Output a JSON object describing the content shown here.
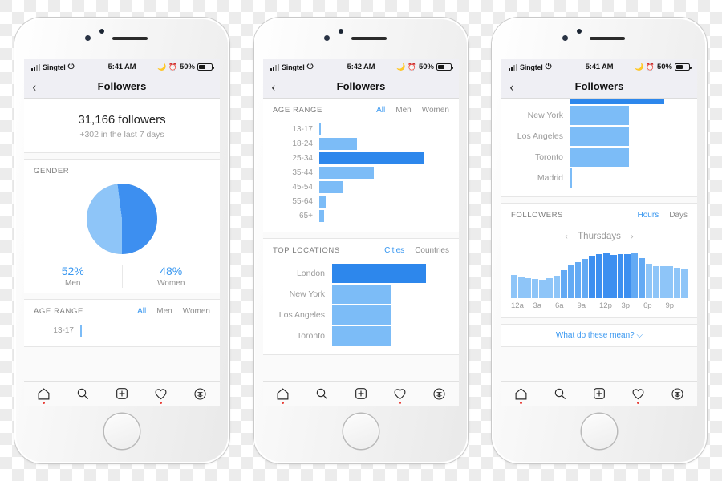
{
  "phones": [
    {
      "id": "phone-1",
      "status": {
        "carrier": "Singtel",
        "time": "5:41 AM",
        "battery": "50%"
      },
      "nav": {
        "back": "‹",
        "title": "Followers"
      },
      "summary": {
        "count": "31,166 followers",
        "delta": "+302 in the last 7 days"
      },
      "gender": {
        "title": "GENDER",
        "men_pct": "52%",
        "men_label": "Men",
        "women_pct": "48%",
        "women_label": "Women"
      },
      "age": {
        "title": "AGE RANGE",
        "segments": [
          "All",
          "Men",
          "Women"
        ],
        "active": "All",
        "rows": [
          {
            "label": "13-17",
            "value": 2
          }
        ]
      }
    },
    {
      "id": "phone-2",
      "status": {
        "carrier": "Singtel",
        "time": "5:42 AM",
        "battery": "50%"
      },
      "nav": {
        "back": "‹",
        "title": "Followers"
      },
      "age": {
        "title": "AGE RANGE",
        "segments": [
          "All",
          "Men",
          "Women"
        ],
        "active": "All",
        "rows": [
          {
            "label": "13-17",
            "value": 2
          },
          {
            "label": "18-24",
            "value": 36
          },
          {
            "label": "25-34",
            "value": 100
          },
          {
            "label": "35-44",
            "value": 52
          },
          {
            "label": "45-54",
            "value": 22
          },
          {
            "label": "55-64",
            "value": 6
          },
          {
            "label": "65+",
            "value": 5
          }
        ]
      },
      "locations": {
        "title": "TOP LOCATIONS",
        "segments": [
          "Cities",
          "Countries"
        ],
        "active": "Cities",
        "rows": [
          {
            "label": "London",
            "value": 100
          },
          {
            "label": "New York",
            "value": 62
          },
          {
            "label": "Los Angeles",
            "value": 62
          },
          {
            "label": "Toronto",
            "value": 62
          }
        ]
      }
    },
    {
      "id": "phone-3",
      "status": {
        "carrier": "Singtel",
        "time": "5:41 AM",
        "battery": "50%"
      },
      "nav": {
        "back": "‹",
        "title": "Followers"
      },
      "locations": {
        "rows": [
          {
            "label": "",
            "value": 100
          },
          {
            "label": "New York",
            "value": 62
          },
          {
            "label": "Los Angeles",
            "value": 62
          },
          {
            "label": "Toronto",
            "value": 62
          },
          {
            "label": "Madrid",
            "value": 0
          }
        ]
      },
      "followers": {
        "title": "FOLLOWERS",
        "segments": [
          "Hours",
          "Days"
        ],
        "active": "Hours",
        "day": "Thursdays",
        "prev": "‹",
        "next": "›",
        "footer": "What do these mean?",
        "footer_caret": "⌵"
      }
    }
  ],
  "tabbar": {
    "items": [
      {
        "icon": "home-icon",
        "dot": true
      },
      {
        "icon": "search-icon",
        "dot": false
      },
      {
        "icon": "plus-icon",
        "dot": false
      },
      {
        "icon": "heart-icon",
        "dot": true
      },
      {
        "icon": "profile-icon",
        "dot": false
      }
    ]
  },
  "colors": {
    "accent": "#3897f0",
    "bar_light": "#8ec5f8",
    "bar_dark": "#2d87ec",
    "muted": "#9a9a9a"
  },
  "chart_data": [
    {
      "type": "pie",
      "title": "GENDER",
      "labels": [
        "Men",
        "Women"
      ],
      "values": [
        52,
        48
      ],
      "colors": [
        "#3d8ff0",
        "#8ec5f8"
      ],
      "unit": "%"
    },
    {
      "type": "bar",
      "orientation": "horizontal",
      "title": "AGE RANGE",
      "categories": [
        "13-17",
        "18-24",
        "25-34",
        "35-44",
        "45-54",
        "55-64",
        "65+"
      ],
      "values": [
        2,
        36,
        100,
        52,
        22,
        6,
        5
      ],
      "xlabel": "",
      "ylabel": "",
      "note": "values are relative bar lengths, 25-34 is the max/highlighted bar",
      "highlight": "25-34"
    },
    {
      "type": "bar",
      "orientation": "horizontal",
      "title": "TOP LOCATIONS",
      "categories": [
        "London",
        "New York",
        "Los Angeles",
        "Toronto",
        "Madrid"
      ],
      "values": [
        100,
        62,
        62,
        62,
        0
      ],
      "highlight": "London",
      "legend": [
        "Cities",
        "Countries"
      ]
    },
    {
      "type": "bar",
      "orientation": "vertical",
      "title": "FOLLOWERS",
      "subtitle": "Thursdays",
      "categories": [
        "12a",
        "1a",
        "2a",
        "3a",
        "4a",
        "5a",
        "6a",
        "7a",
        "8a",
        "9a",
        "10a",
        "11a",
        "12p",
        "1p",
        "2p",
        "3p",
        "4p",
        "5p",
        "6p",
        "7p",
        "8p",
        "9p",
        "10p",
        "11p"
      ],
      "tick_labels": [
        "12a",
        "3a",
        "6a",
        "9a",
        "12p",
        "3p",
        "6p",
        "9p"
      ],
      "values": [
        46,
        43,
        40,
        38,
        37,
        40,
        45,
        56,
        66,
        72,
        79,
        85,
        88,
        90,
        87,
        88,
        88,
        90,
        80,
        70,
        64,
        64,
        64,
        62,
        58
      ],
      "ylim": [
        0,
        100
      ],
      "grid": false,
      "legend": [
        "Hours",
        "Days"
      ]
    }
  ]
}
